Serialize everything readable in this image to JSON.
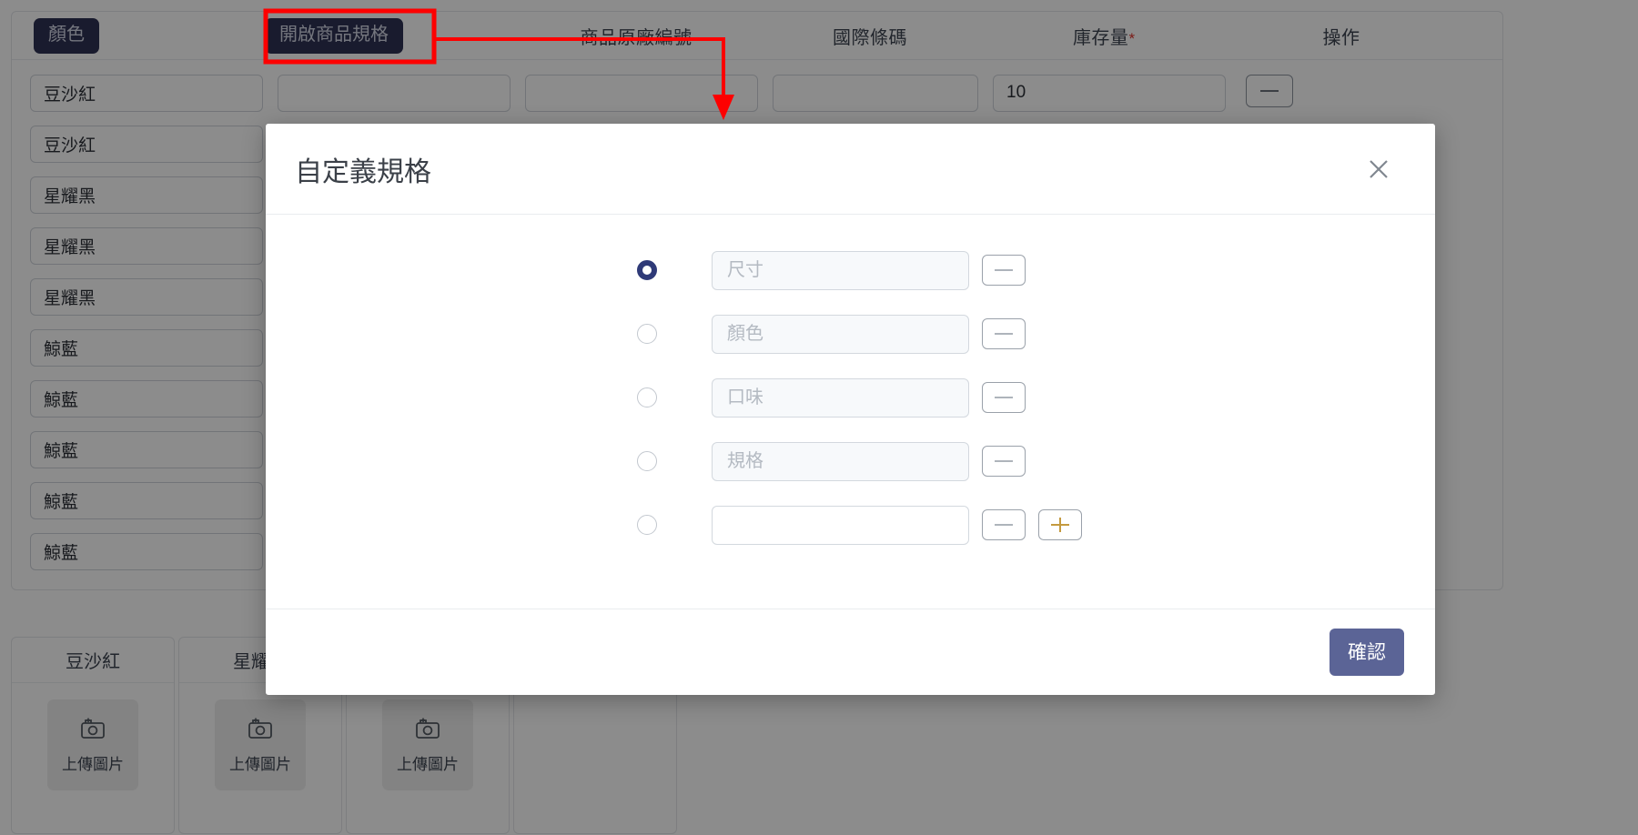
{
  "table": {
    "headers": {
      "color_tag": "顏色",
      "open_spec_button": "開啟商品規格",
      "mfr_code": "商品原廠編號",
      "barcode": "國際條碼",
      "stock": "庫存量",
      "stock_required_mark": "*",
      "action": "操作"
    },
    "rows": [
      {
        "color": "豆沙紅",
        "mfr_code": "",
        "barcode": "",
        "stock": "10"
      },
      {
        "color": "豆沙紅",
        "mfr_code": "",
        "barcode": "",
        "stock": ""
      },
      {
        "color": "星耀黑",
        "mfr_code": "",
        "barcode": "",
        "stock": ""
      },
      {
        "color": "星耀黑",
        "mfr_code": "",
        "barcode": "",
        "stock": ""
      },
      {
        "color": "星耀黑",
        "mfr_code": "",
        "barcode": "",
        "stock": ""
      },
      {
        "color": "鯨藍",
        "mfr_code": "",
        "barcode": "",
        "stock": ""
      },
      {
        "color": "鯨藍",
        "mfr_code": "",
        "barcode": "",
        "stock": ""
      },
      {
        "color": "鯨藍",
        "mfr_code": "",
        "barcode": "",
        "stock": ""
      },
      {
        "color": "鯨藍",
        "mfr_code": "",
        "barcode": "",
        "stock": ""
      },
      {
        "color": "鯨藍",
        "mfr_code": "",
        "barcode": "",
        "stock": ""
      }
    ]
  },
  "image_cards": [
    {
      "title": "豆沙紅",
      "upload_label": "上傳圖片",
      "icon": "camera-plus-icon"
    },
    {
      "title": "星耀黑",
      "upload_label": "上傳圖片",
      "icon": "camera-plus-icon"
    },
    {
      "title": "",
      "upload_label": "上傳圖片",
      "icon": "camera-plus-icon"
    },
    {
      "title": "",
      "upload_label": "",
      "icon": ""
    }
  ],
  "modal": {
    "title": "自定義規格",
    "close_icon": "close-icon",
    "rows": [
      {
        "placeholder": "尺寸",
        "value": "",
        "selected": true,
        "minus_label": "−",
        "has_plus": false,
        "filled": true
      },
      {
        "placeholder": "顏色",
        "value": "",
        "selected": false,
        "minus_label": "−",
        "has_plus": false,
        "filled": true
      },
      {
        "placeholder": "口味",
        "value": "",
        "selected": false,
        "minus_label": "−",
        "has_plus": false,
        "filled": true
      },
      {
        "placeholder": "規格",
        "value": "",
        "selected": false,
        "minus_label": "−",
        "has_plus": false,
        "filled": true
      },
      {
        "placeholder": "",
        "value": "",
        "selected": false,
        "minus_label": "−",
        "has_plus": true,
        "filled": false
      }
    ],
    "confirm_label": "確認"
  },
  "annotation": {
    "color": "#fd0000",
    "highlight_target": "開啟商品規格",
    "arrow_points": "box around open-spec button, elbow line to downward arrow over row input"
  },
  "colors": {
    "tag_bg": "#2f3254",
    "confirm_bg": "#5b6496",
    "radio_selected": "#2f3a78",
    "plus_icon": "#c49a3f",
    "required_star": "#e2332c",
    "annotation_red": "#fd0000",
    "overlay": "rgba(0,0,0,0.45)"
  }
}
